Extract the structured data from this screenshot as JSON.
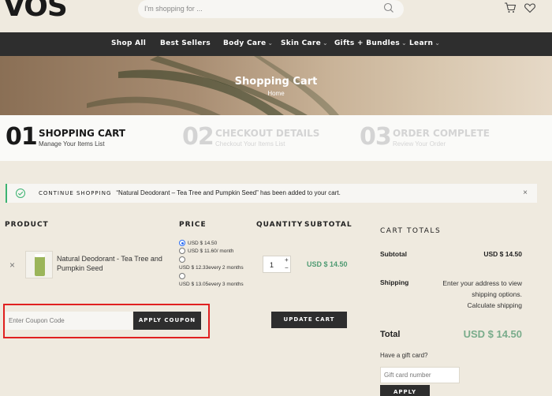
{
  "header": {
    "logo": "VOS",
    "search_placeholder": "I'm shopping for ...",
    "icons": [
      "search-icon",
      "cart-icon",
      "heart-icon"
    ]
  },
  "nav": {
    "items": [
      {
        "label": "Shop All",
        "has_dropdown": false
      },
      {
        "label": "Best Sellers",
        "has_dropdown": false
      },
      {
        "label": "Body Care",
        "has_dropdown": true
      },
      {
        "label": "Skin Care",
        "has_dropdown": true
      },
      {
        "label": "Gifts + Bundles",
        "has_dropdown": true
      },
      {
        "label": "Learn",
        "has_dropdown": true
      }
    ]
  },
  "banner": {
    "title": "Shopping Cart",
    "breadcrumb": "Home"
  },
  "steps": [
    {
      "num": "01",
      "title": "SHOPPING CART",
      "subtitle": "Manage Your Items List",
      "active": true
    },
    {
      "num": "02",
      "title": "CHECKOUT DETAILS",
      "subtitle": "Checkout Your Items List",
      "active": false
    },
    {
      "num": "03",
      "title": "ORDER COMPLETE",
      "subtitle": "Review Your Order",
      "active": false
    }
  ],
  "notice": {
    "link": "CONTINUE SHOPPING",
    "message": "“Natural Deodorant – Tea Tree and Pumpkin Seed” has been added to your cart.",
    "close": "×"
  },
  "table": {
    "headers": {
      "product": "PRODUCT",
      "price": "PRICE",
      "quantity": "QUANTITY",
      "subtotal": "SUBTOTAL"
    },
    "row": {
      "remove": "×",
      "product_name": "Natural Deodorant - Tea Tree and Pumpkin Seed",
      "price_options": [
        {
          "label": "USD $ 14.50",
          "selected": true
        },
        {
          "label": "USD $ 11.60/ month",
          "selected": false
        },
        {
          "label": "USD $ 12.33every 2 months",
          "selected": false
        },
        {
          "label": "USD $ 13.05every 3 months",
          "selected": false
        }
      ],
      "quantity": "1",
      "qty_up": "+",
      "qty_down": "−",
      "subtotal": "USD $ 14.50"
    }
  },
  "coupon": {
    "placeholder": "Enter Coupon Code",
    "apply_label": "APPLY COUPON",
    "update_label": "UPDATE CART"
  },
  "totals": {
    "title": "CART TOTALS",
    "subtotal_label": "Subtotal",
    "subtotal_value": "USD $ 14.50",
    "shipping_label": "Shipping",
    "shipping_line1": "Enter your address to view",
    "shipping_line2": "shipping options.",
    "shipping_link": "Calculate shipping",
    "total_label": "Total",
    "total_value": "USD $ 14.50",
    "gift_question": "Have a gift card?",
    "gift_placeholder": "Gift card number",
    "gift_apply": "APPLY"
  },
  "colors": {
    "page_bg": "#efeadf",
    "nav_bg": "#2e2e2e",
    "accent_green": "#4e9a72",
    "total_green": "#79ac8b",
    "highlight_red": "#e02020"
  }
}
